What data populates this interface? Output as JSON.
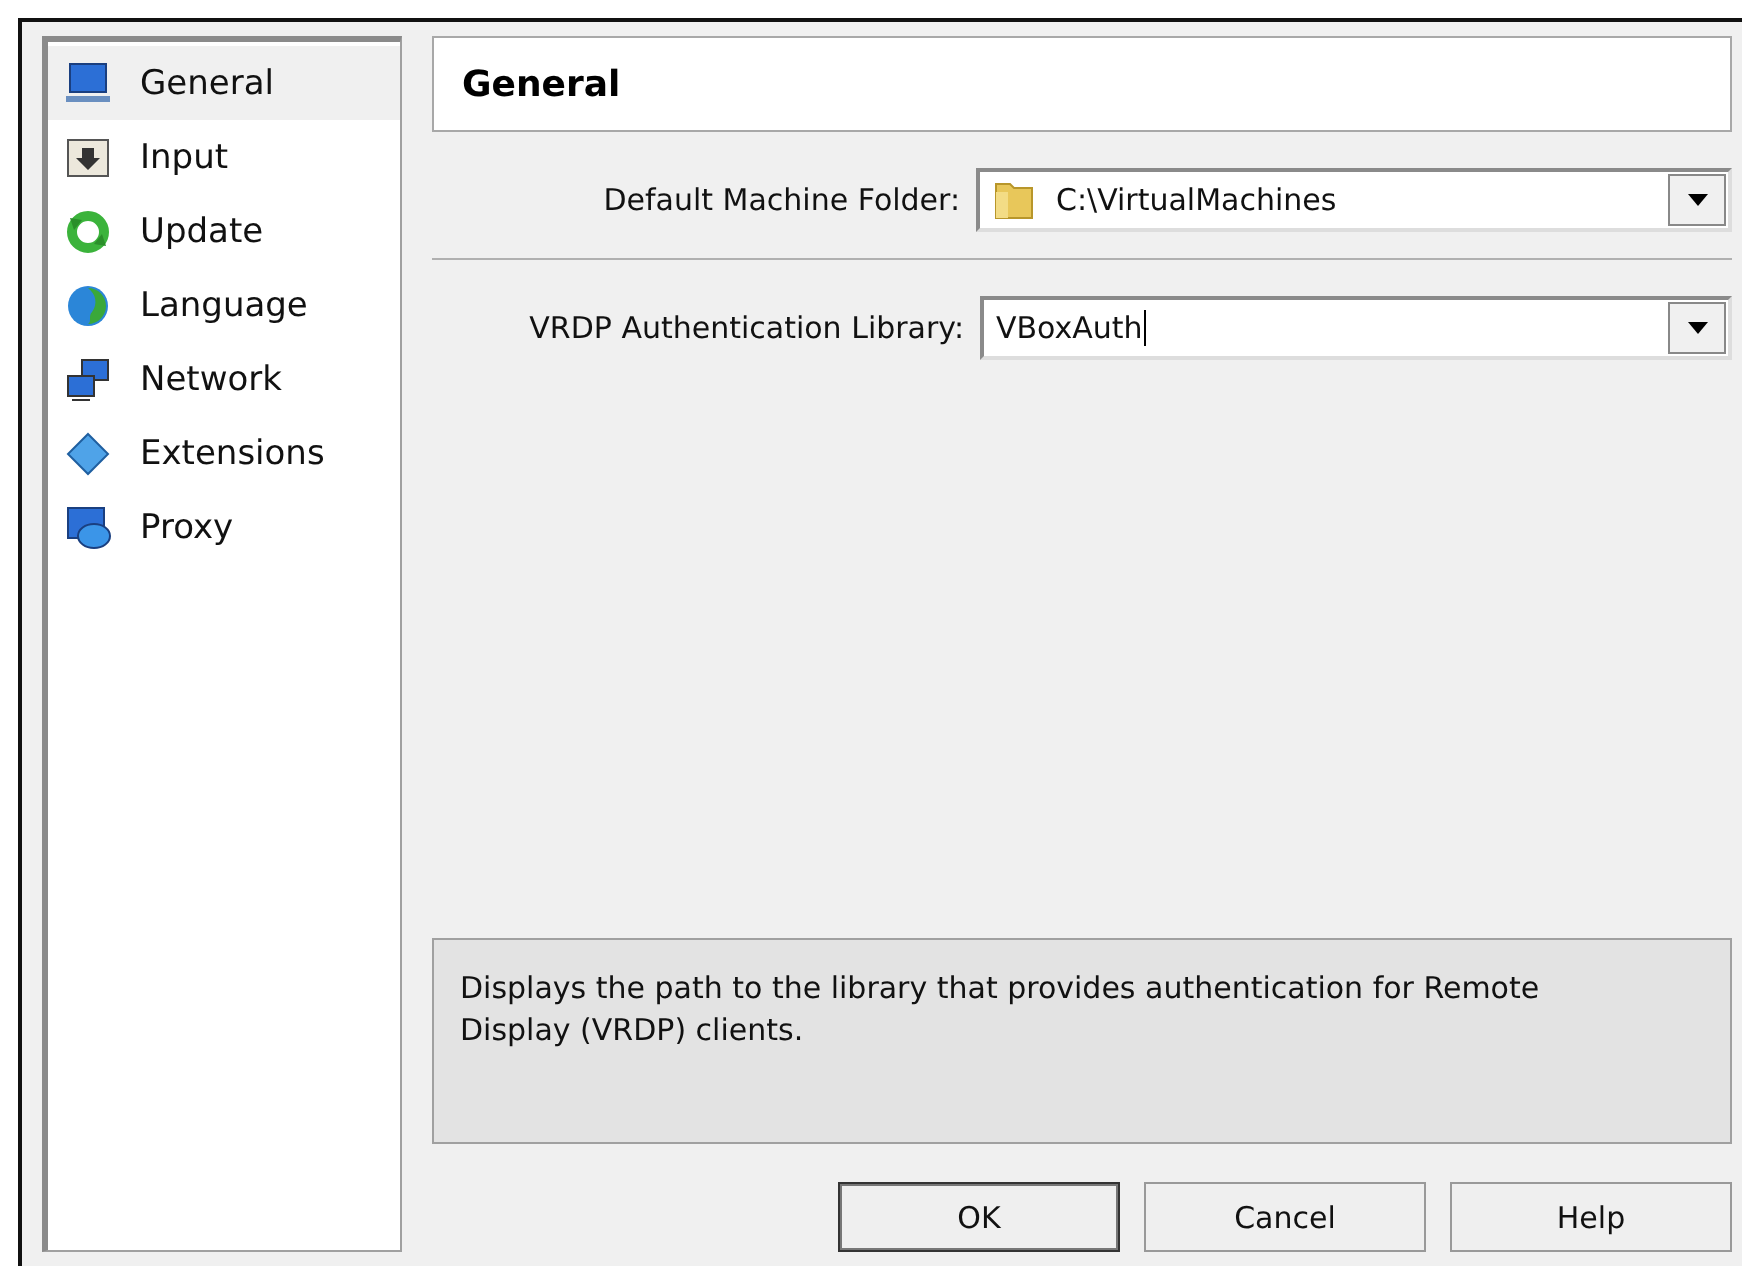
{
  "sidebar": {
    "items": [
      {
        "label": "General",
        "kind": "monitor",
        "selected": true
      },
      {
        "label": "Input",
        "kind": "input",
        "selected": false
      },
      {
        "label": "Update",
        "kind": "update",
        "selected": false
      },
      {
        "label": "Language",
        "kind": "globe",
        "selected": false
      },
      {
        "label": "Network",
        "kind": "network",
        "selected": false
      },
      {
        "label": "Extensions",
        "kind": "diamond",
        "selected": false
      },
      {
        "label": "Proxy",
        "kind": "proxy",
        "selected": false
      }
    ]
  },
  "page": {
    "title": "General",
    "fields": [
      {
        "label": "Default Machine Folder:",
        "value": "C:\\VirtualMachines",
        "kind": "folder"
      },
      {
        "label": "VRDP Authentication Library:",
        "value": "VBoxAuth",
        "kind": "text"
      }
    ],
    "description": "Displays the path to the library that provides authentication for Remote Display (VRDP) clients."
  },
  "buttons": [
    {
      "label": "OK",
      "default": true
    },
    {
      "label": "Cancel",
      "default": false
    },
    {
      "label": "Help",
      "default": false
    }
  ]
}
